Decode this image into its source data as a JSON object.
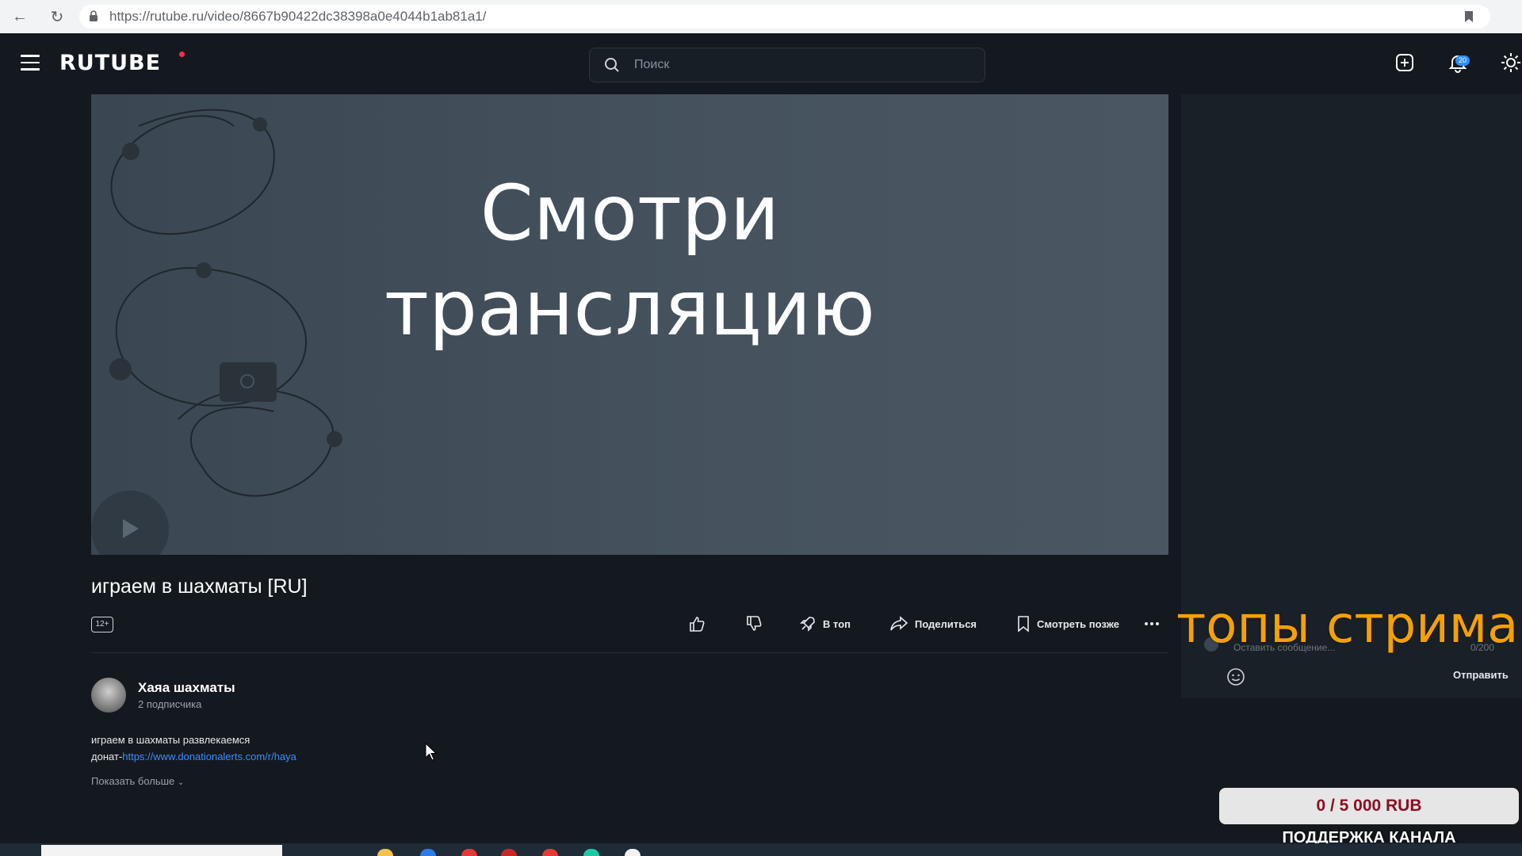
{
  "browser": {
    "url": "https://rutube.ru/video/8667b90422dc38398a0e4044b1ab81a1/"
  },
  "header": {
    "logo": "RUTUBE",
    "search_placeholder": "Поиск",
    "notifications_count": "20"
  },
  "player": {
    "title_line1": "Смотри",
    "title_line2": "трансляцию"
  },
  "video": {
    "title": "играем в шахматы [RU]",
    "age_rating": "12+",
    "actions": {
      "to_top": "В топ",
      "share": "Поделиться",
      "watch_later": "Смотреть позже"
    }
  },
  "channel": {
    "name": "Хаяа шахматы",
    "subscribers": "2 подписчика"
  },
  "description": {
    "line1": "играем в шахматы развлекаемся",
    "line2_prefix": "донат-",
    "line2_link": "https://www.donationalerts.com/r/haya",
    "show_more": "Показать больше"
  },
  "chat": {
    "input_placeholder": "Оставить сообщение...",
    "counter": "0/200",
    "send_label": "Отправить"
  },
  "overlay": {
    "stream_title": "топы стрима",
    "donation_progress": "0 / 5 000 RUB",
    "donation_label": "ПОДДЕРЖКА КАНАЛА"
  },
  "colors": {
    "page_bg": "#14191f",
    "accent_link": "#3d8bff",
    "logo_dot": "#ff2b4f",
    "overlay_title": "#f6a100",
    "donation_text": "#8a1022"
  }
}
